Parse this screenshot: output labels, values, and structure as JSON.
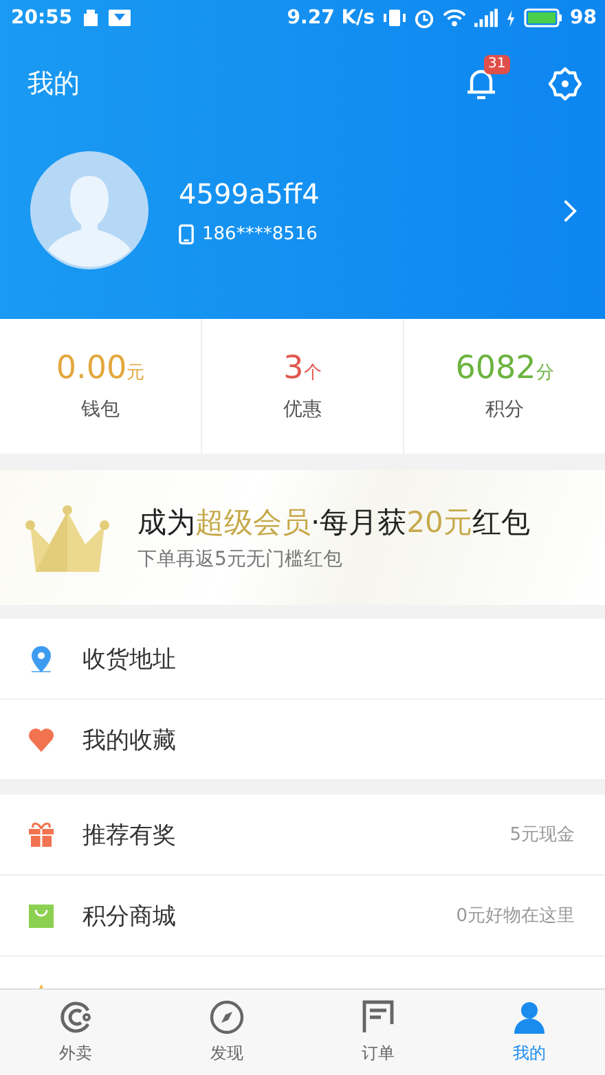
{
  "status_bar": {
    "time": "20:55",
    "speed": "9.27 K/s",
    "battery": "98"
  },
  "header": {
    "title": "我的",
    "notification_count": "31"
  },
  "profile": {
    "username": "4599a5ff4",
    "phone": "186****8516"
  },
  "stats": [
    {
      "value": "0.00",
      "unit": "元",
      "label": "钱包",
      "color": "#e3a73d"
    },
    {
      "value": "3",
      "unit": "个",
      "label": "优惠",
      "color": "#e0574f"
    },
    {
      "value": "6082",
      "unit": "分",
      "label": "积分",
      "color": "#6cb33f"
    }
  ],
  "banner": {
    "headline": "成为**超级会员**·每月获**20元**红包",
    "subtitle": "下单再返5元无门槛红包"
  },
  "menu_groups": [
    [
      {
        "kind": "location",
        "label": "收货地址"
      },
      {
        "kind": "heart",
        "label": "我的收藏"
      }
    ],
    [
      {
        "kind": "gift",
        "label": "推荐有奖",
        "detail": "5元现金"
      },
      {
        "kind": "bag",
        "label": "积分商城",
        "detail": "0元好物在这里"
      },
      {
        "kind": "star"
      }
    ]
  ],
  "tabs": [
    {
      "kind": "takeout",
      "label": "外卖",
      "selected": false
    },
    {
      "kind": "discover",
      "label": "发现",
      "selected": false
    },
    {
      "kind": "orders",
      "label": "订单",
      "selected": false
    },
    {
      "kind": "me",
      "label": "我的",
      "selected": true
    }
  ]
}
